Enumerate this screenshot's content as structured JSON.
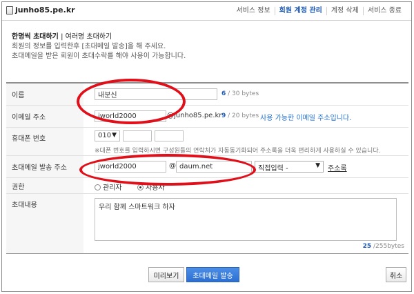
{
  "header": {
    "site": "junho85.pe.kr",
    "nav": [
      "서비스 정보",
      "회원 계정 관리",
      "계정 삭제",
      "서비스 종료"
    ],
    "active_index": 1
  },
  "intro": {
    "title_active": "한명씩 초대하기",
    "title_sep": " | ",
    "title_other": "여러명 초대하기",
    "desc1": "회원의 정보를 입력한후 [초대메일 발송]을 해 주세요.",
    "desc2": "초대메일을 받은 회원이 초대수락를 해야 사용이 가능합니다."
  },
  "form": {
    "name": {
      "label": "이름",
      "value": "내분신",
      "count": "6",
      "max": " / 30 bytes"
    },
    "email": {
      "label": "이메일 주소",
      "value": "jworld2000",
      "domain": "@junho85.pe.kr",
      "count": "9",
      "max": " / 20 bytes",
      "status": "사용 가능한 이메일 주소입니다."
    },
    "phone": {
      "label": "휴대폰 번호",
      "prefix": "010",
      "note": "※대폰 번호를 입력하시면 구성원들의 연락처가 자동동기화되어 주소록을 더욱 편리하게 사용하실 수 있습니다."
    },
    "invite_email": {
      "label": "초대메일 발송 주소",
      "user": "jworld2000",
      "at": "@",
      "domain": "daum.net",
      "select": "직접입력 -",
      "addrbook": "주소록"
    },
    "permission": {
      "label": "권한",
      "options": [
        "관리자",
        "사용자"
      ],
      "selected_index": 1
    },
    "message": {
      "label": "초대내용",
      "value": "우리 함께 스마트워크 하자",
      "count": "25",
      "max": " /255bytes"
    }
  },
  "buttons": {
    "preview": "미리보기",
    "send": "초대메일 발송",
    "cancel": "취소"
  },
  "colors": {
    "accent": "#1f5bb5",
    "annotation": "#e0101b",
    "primary_button": "#2d6fd1"
  }
}
